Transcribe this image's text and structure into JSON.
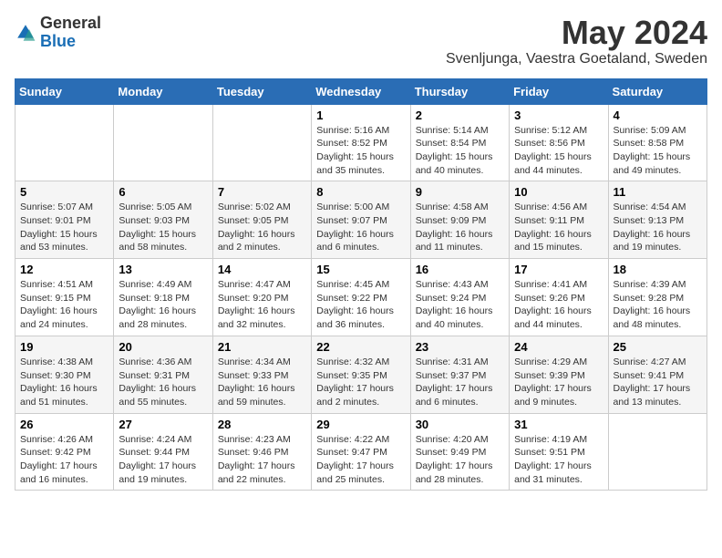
{
  "header": {
    "logo_general": "General",
    "logo_blue": "Blue",
    "month_title": "May 2024",
    "location": "Svenljunga, Vaestra Goetaland, Sweden"
  },
  "days_of_week": [
    "Sunday",
    "Monday",
    "Tuesday",
    "Wednesday",
    "Thursday",
    "Friday",
    "Saturday"
  ],
  "weeks": [
    [
      {
        "day": "",
        "info": ""
      },
      {
        "day": "",
        "info": ""
      },
      {
        "day": "",
        "info": ""
      },
      {
        "day": "1",
        "info": "Sunrise: 5:16 AM\nSunset: 8:52 PM\nDaylight: 15 hours\nand 35 minutes."
      },
      {
        "day": "2",
        "info": "Sunrise: 5:14 AM\nSunset: 8:54 PM\nDaylight: 15 hours\nand 40 minutes."
      },
      {
        "day": "3",
        "info": "Sunrise: 5:12 AM\nSunset: 8:56 PM\nDaylight: 15 hours\nand 44 minutes."
      },
      {
        "day": "4",
        "info": "Sunrise: 5:09 AM\nSunset: 8:58 PM\nDaylight: 15 hours\nand 49 minutes."
      }
    ],
    [
      {
        "day": "5",
        "info": "Sunrise: 5:07 AM\nSunset: 9:01 PM\nDaylight: 15 hours\nand 53 minutes."
      },
      {
        "day": "6",
        "info": "Sunrise: 5:05 AM\nSunset: 9:03 PM\nDaylight: 15 hours\nand 58 minutes."
      },
      {
        "day": "7",
        "info": "Sunrise: 5:02 AM\nSunset: 9:05 PM\nDaylight: 16 hours\nand 2 minutes."
      },
      {
        "day": "8",
        "info": "Sunrise: 5:00 AM\nSunset: 9:07 PM\nDaylight: 16 hours\nand 6 minutes."
      },
      {
        "day": "9",
        "info": "Sunrise: 4:58 AM\nSunset: 9:09 PM\nDaylight: 16 hours\nand 11 minutes."
      },
      {
        "day": "10",
        "info": "Sunrise: 4:56 AM\nSunset: 9:11 PM\nDaylight: 16 hours\nand 15 minutes."
      },
      {
        "day": "11",
        "info": "Sunrise: 4:54 AM\nSunset: 9:13 PM\nDaylight: 16 hours\nand 19 minutes."
      }
    ],
    [
      {
        "day": "12",
        "info": "Sunrise: 4:51 AM\nSunset: 9:15 PM\nDaylight: 16 hours\nand 24 minutes."
      },
      {
        "day": "13",
        "info": "Sunrise: 4:49 AM\nSunset: 9:18 PM\nDaylight: 16 hours\nand 28 minutes."
      },
      {
        "day": "14",
        "info": "Sunrise: 4:47 AM\nSunset: 9:20 PM\nDaylight: 16 hours\nand 32 minutes."
      },
      {
        "day": "15",
        "info": "Sunrise: 4:45 AM\nSunset: 9:22 PM\nDaylight: 16 hours\nand 36 minutes."
      },
      {
        "day": "16",
        "info": "Sunrise: 4:43 AM\nSunset: 9:24 PM\nDaylight: 16 hours\nand 40 minutes."
      },
      {
        "day": "17",
        "info": "Sunrise: 4:41 AM\nSunset: 9:26 PM\nDaylight: 16 hours\nand 44 minutes."
      },
      {
        "day": "18",
        "info": "Sunrise: 4:39 AM\nSunset: 9:28 PM\nDaylight: 16 hours\nand 48 minutes."
      }
    ],
    [
      {
        "day": "19",
        "info": "Sunrise: 4:38 AM\nSunset: 9:30 PM\nDaylight: 16 hours\nand 51 minutes."
      },
      {
        "day": "20",
        "info": "Sunrise: 4:36 AM\nSunset: 9:31 PM\nDaylight: 16 hours\nand 55 minutes."
      },
      {
        "day": "21",
        "info": "Sunrise: 4:34 AM\nSunset: 9:33 PM\nDaylight: 16 hours\nand 59 minutes."
      },
      {
        "day": "22",
        "info": "Sunrise: 4:32 AM\nSunset: 9:35 PM\nDaylight: 17 hours\nand 2 minutes."
      },
      {
        "day": "23",
        "info": "Sunrise: 4:31 AM\nSunset: 9:37 PM\nDaylight: 17 hours\nand 6 minutes."
      },
      {
        "day": "24",
        "info": "Sunrise: 4:29 AM\nSunset: 9:39 PM\nDaylight: 17 hours\nand 9 minutes."
      },
      {
        "day": "25",
        "info": "Sunrise: 4:27 AM\nSunset: 9:41 PM\nDaylight: 17 hours\nand 13 minutes."
      }
    ],
    [
      {
        "day": "26",
        "info": "Sunrise: 4:26 AM\nSunset: 9:42 PM\nDaylight: 17 hours\nand 16 minutes."
      },
      {
        "day": "27",
        "info": "Sunrise: 4:24 AM\nSunset: 9:44 PM\nDaylight: 17 hours\nand 19 minutes."
      },
      {
        "day": "28",
        "info": "Sunrise: 4:23 AM\nSunset: 9:46 PM\nDaylight: 17 hours\nand 22 minutes."
      },
      {
        "day": "29",
        "info": "Sunrise: 4:22 AM\nSunset: 9:47 PM\nDaylight: 17 hours\nand 25 minutes."
      },
      {
        "day": "30",
        "info": "Sunrise: 4:20 AM\nSunset: 9:49 PM\nDaylight: 17 hours\nand 28 minutes."
      },
      {
        "day": "31",
        "info": "Sunrise: 4:19 AM\nSunset: 9:51 PM\nDaylight: 17 hours\nand 31 minutes."
      },
      {
        "day": "",
        "info": ""
      }
    ]
  ]
}
